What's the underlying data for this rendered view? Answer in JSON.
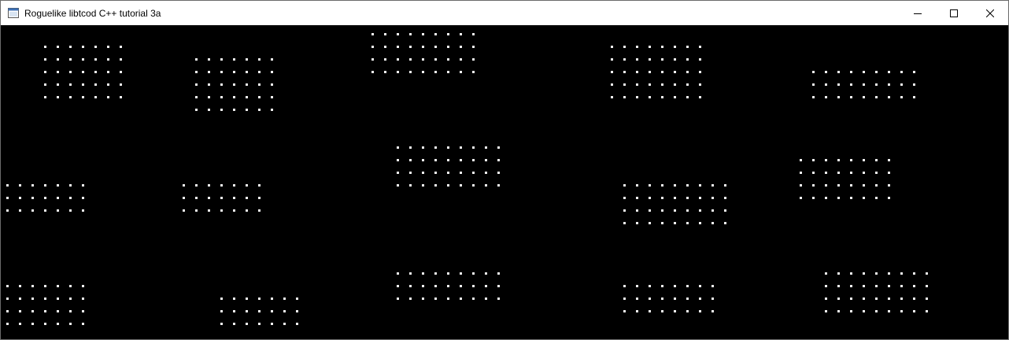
{
  "window": {
    "title": "Roguelike libtcod C++ tutorial 3a",
    "app_icon": "console-window-icon",
    "controls": {
      "minimize_icon": "minimize-icon",
      "maximize_icon": "maximize-icon",
      "close_icon": "close-icon"
    }
  },
  "console": {
    "background": "#000000",
    "floor_color": "#f2f2f2",
    "floor_glyph": "·",
    "rooms": [
      {
        "name": "room-1",
        "cols": 7,
        "rows": 5
      },
      {
        "name": "room-2",
        "cols": 7,
        "rows": 5
      },
      {
        "name": "room-3",
        "cols": 9,
        "rows": 4
      },
      {
        "name": "room-4",
        "cols": 8,
        "rows": 5
      },
      {
        "name": "room-5",
        "cols": 9,
        "rows": 3
      },
      {
        "name": "room-6",
        "cols": 7,
        "rows": 3
      },
      {
        "name": "room-7",
        "cols": 7,
        "rows": 3
      },
      {
        "name": "room-8",
        "cols": 9,
        "rows": 4
      },
      {
        "name": "room-9",
        "cols": 8,
        "rows": 4
      },
      {
        "name": "room-10",
        "cols": 9,
        "rows": 4
      },
      {
        "name": "room-11",
        "cols": 7,
        "rows": 4
      },
      {
        "name": "room-12",
        "cols": 7,
        "rows": 3
      },
      {
        "name": "room-13",
        "cols": 9,
        "rows": 3
      },
      {
        "name": "room-14",
        "cols": 8,
        "rows": 3
      },
      {
        "name": "room-15",
        "cols": 9,
        "rows": 4
      }
    ]
  }
}
